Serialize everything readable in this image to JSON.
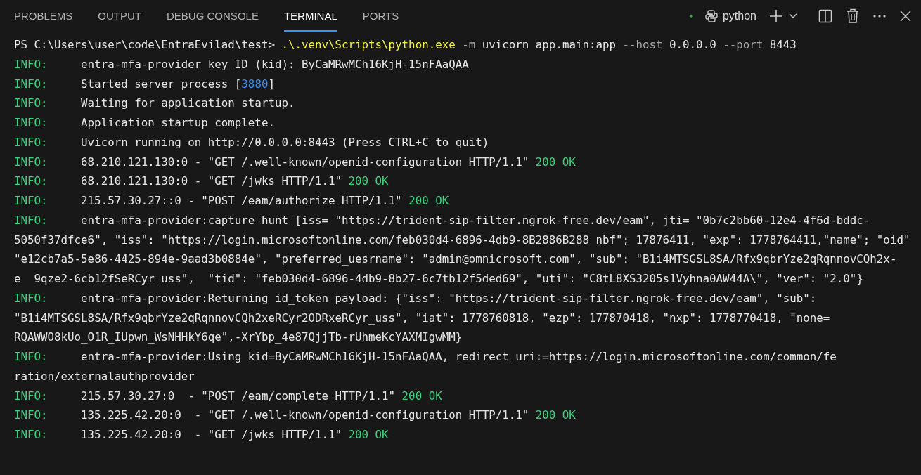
{
  "tabs": [
    {
      "label": "PROBLEMS",
      "selected": false
    },
    {
      "label": "OUTPUT",
      "selected": false
    },
    {
      "label": "DEBUG CONSOLE",
      "selected": false
    },
    {
      "label": "TERMINAL",
      "selected": true
    },
    {
      "label": "PORTS",
      "selected": false
    }
  ],
  "terminal_profile": {
    "name": "python"
  },
  "lines": [
    {
      "segments": [
        {
          "kind": "text",
          "text": "PS C:\\Users\\user\\code\\EntraEvilad\\test> "
        },
        {
          "kind": "command",
          "text": ".\\.venv\\Scripts\\python.exe"
        },
        {
          "kind": "flag",
          "text": " -m"
        },
        {
          "kind": "text",
          "text": " uvicorn app.main:app"
        },
        {
          "kind": "flag",
          "text": " --host"
        },
        {
          "kind": "text",
          "text": " 0.0.0.0"
        },
        {
          "kind": "flag",
          "text": " --port"
        },
        {
          "kind": "text",
          "text": " 8443"
        }
      ]
    },
    {
      "level": "INFO:",
      "segments": [
        {
          "kind": "text",
          "text": "entra-mfa-provider key ID (kid): ByCaMRwMCh16KjH-15nFAaQAA"
        }
      ]
    },
    {
      "level": "INFO:",
      "segments": [
        {
          "kind": "text",
          "text": "Started server process ["
        },
        {
          "kind": "number",
          "text": "3880"
        },
        {
          "kind": "text",
          "text": "]"
        }
      ]
    },
    {
      "level": "INFO:",
      "segments": [
        {
          "kind": "text",
          "text": "Waiting for application startup."
        }
      ]
    },
    {
      "level": "INFO:",
      "segments": [
        {
          "kind": "text",
          "text": "Application startup complete."
        }
      ]
    },
    {
      "level": "INFO:",
      "segments": [
        {
          "kind": "text",
          "text": "Uvicorn running on http://0.0.0.0:8443 (Press CTRL+C to quit)"
        }
      ]
    },
    {
      "level": "INFO:",
      "segments": [
        {
          "kind": "text",
          "text": "68.210.121.130:0 - \"GET /.well-known/openid-configuration HTTP/1.1\" "
        },
        {
          "kind": "ok",
          "text": "200 OK"
        }
      ]
    },
    {
      "level": "INFO:",
      "segments": [
        {
          "kind": "text",
          "text": "68.210.121.130:0 - \"GET /jwks HTTP/1.1\" "
        },
        {
          "kind": "ok",
          "text": "200 OK"
        }
      ]
    },
    {
      "level": "INFO:",
      "segments": [
        {
          "kind": "text",
          "text": "215.57.30.27::0 - \"POST /eam/authorize HTTP/1.1\" "
        },
        {
          "kind": "ok",
          "text": "200 OK"
        }
      ]
    },
    {
      "level": "INFO:",
      "segments": [
        {
          "kind": "text",
          "text": "entra-mfa-provider:capture hunt [iss= \"https://trident-sip-filter.ngrok-free.dev/eam\", jti= \"0b7c2bb60-12e4-4f6d-bddc-"
        }
      ]
    },
    {
      "segments": [
        {
          "kind": "text",
          "text": "5050f37dfce6\", \"iss\": \"https://login.microsoftonline.com/feb030d4-6896-4db9-8B2886B288 nbf\"; 17876411, \"exp\": 1778764411,\"name\"; \"oid\""
        }
      ]
    },
    {
      "segments": [
        {
          "kind": "text",
          "text": "\"e12cb7a5-5e86-4425-894e-9aad3b0884e\", \"preferred_uesrname\": \"admin@omnicrosoft.com\", \"sub\": \"B1i4MTSGSL8SA/Rfx9qbrYze2qRqnnovCQh2x-"
        }
      ]
    },
    {
      "segments": [
        {
          "kind": "text",
          "text": "e  9qze2-6cb12fSeRCyr_uss\",  \"tid\": \"feb030d4-6896-4db9-8b27-6c7tb12f5ded69\", \"uti\": \"C8tL8XS3205s1Vyhna0AW44A\\\", \"ver\": \"2.0\"}"
        }
      ]
    },
    {
      "level": "INFO:",
      "segments": [
        {
          "kind": "text",
          "text": "entra-mfa-provider:Returning id_token payload: {\"iss\": \"https://trident-sip-filter.ngrok-free.dev/eam\", \"sub\":"
        }
      ]
    },
    {
      "segments": [
        {
          "kind": "text",
          "text": "\"B1i4MTSGSL8SA/Rfx9qbrYze2qRqnnovCQh2xeRCyr2ODRxeRCyr_uss\", \"iat\": 1778760818, \"ezp\": 177870418, \"nxp\": 1778770418, \"none="
        }
      ]
    },
    {
      "segments": [
        {
          "kind": "text",
          "text": "RQAWWO8kUo_O1R_IUpwn_WsNHHkY6qe\",-XrYbp_4e87QjjTb-rUhmeKcYAXMIgwMM}"
        }
      ]
    },
    {
      "level": "INFO:",
      "segments": [
        {
          "kind": "text",
          "text": "entra-mfa-provider:Using kid=ByCaMRwMCh16KjH-15nFAaQAA, redirect_uri:=https://login.microsoftonline.com/common/fe"
        }
      ]
    },
    {
      "segments": [
        {
          "kind": "text",
          "text": "ration/externalauthprovider"
        }
      ]
    },
    {
      "level": "INFO:",
      "segments": [
        {
          "kind": "text",
          "text": "215.57.30.27:0  - \"POST /eam/complete HTTP/1.1\" "
        },
        {
          "kind": "ok",
          "text": "200 OK"
        }
      ]
    },
    {
      "level": "INFO:",
      "segments": [
        {
          "kind": "text",
          "text": "135.225.42.20:0  - \"GET /.well-known/openid-configuration HTTP/1.1\" "
        },
        {
          "kind": "ok",
          "text": "200 OK"
        }
      ]
    },
    {
      "level": "INFO:",
      "segments": [
        {
          "kind": "text",
          "text": "135.225.42.20:0  - \"GET /jwks HTTP/1.1\" "
        },
        {
          "kind": "ok",
          "text": "200 OK"
        }
      ]
    }
  ]
}
